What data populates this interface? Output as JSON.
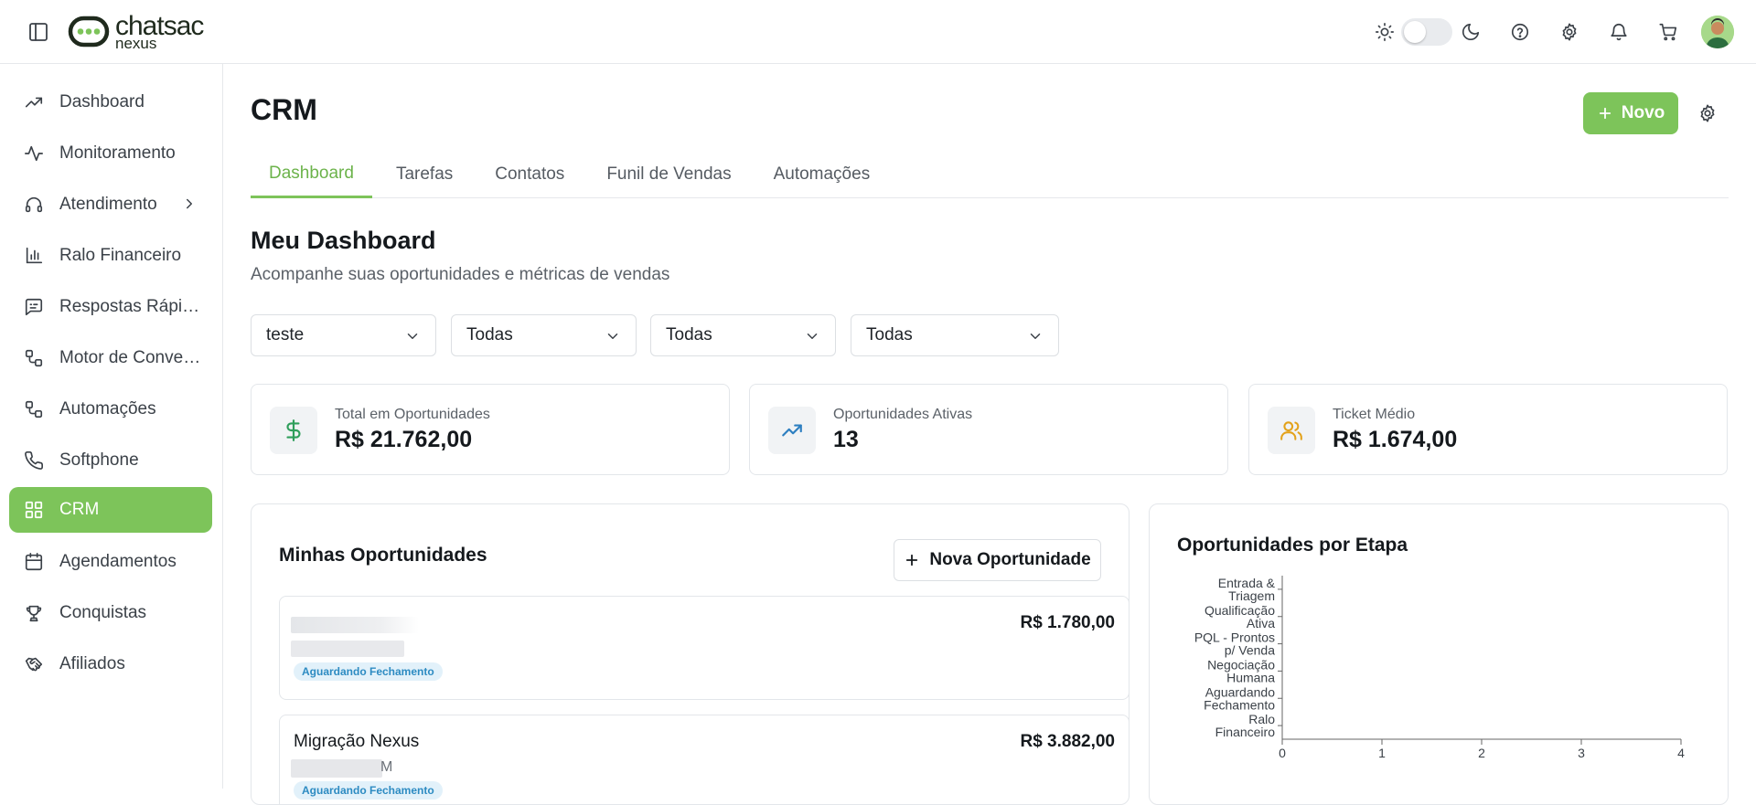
{
  "brand": {
    "line1": "chatsac",
    "line2": "nexus"
  },
  "sidebar": {
    "items": [
      {
        "label": "Dashboard",
        "icon": "trending-up-icon"
      },
      {
        "label": "Monitoramento",
        "icon": "activity-icon"
      },
      {
        "label": "Atendimento",
        "icon": "headset-icon"
      },
      {
        "label": "Ralo Financeiro",
        "icon": "bar-chart-icon"
      },
      {
        "label": "Respostas Rápidas",
        "icon": "message-square-icon"
      },
      {
        "label": "Motor de Conversação",
        "icon": "workflow-icon"
      },
      {
        "label": "Automações",
        "icon": "automation-icon"
      },
      {
        "label": "Softphone",
        "icon": "phone-icon"
      },
      {
        "label": "CRM",
        "icon": "grid-icon"
      },
      {
        "label": "Agendamentos",
        "icon": "calendar-icon"
      },
      {
        "label": "Conquistas",
        "icon": "trophy-icon"
      },
      {
        "label": "Afiliados",
        "icon": "handshake-icon"
      }
    ]
  },
  "page": {
    "title": "CRM",
    "new_button": "Novo"
  },
  "tabs": [
    "Dashboard",
    "Tarefas",
    "Contatos",
    "Funil de Vendas",
    "Automações"
  ],
  "dashboard": {
    "title": "Meu Dashboard",
    "subtitle": "Acompanhe suas oportunidades e métricas de vendas"
  },
  "filters": [
    "teste",
    "Todas",
    "Todas",
    "Todas"
  ],
  "stats": [
    {
      "label": "Total em Oportunidades",
      "value": "R$ 21.762,00",
      "icon": "dollar-icon",
      "color": "#2f9e5b"
    },
    {
      "label": "Oportunidades Ativas",
      "value": "13",
      "icon": "trending-up-icon",
      "color": "#2d7fc1"
    },
    {
      "label": "Ticket Médio",
      "value": "R$ 1.674,00",
      "icon": "users-icon",
      "color": "#e3a21a"
    }
  ],
  "opportunities": {
    "title": "Minhas Oportunidades",
    "new_button": "Nova Oportunidade",
    "items": [
      {
        "name": "",
        "value": "R$ 1.780,00",
        "status": "Aguardando Fechamento"
      },
      {
        "name": "Migração Nexus",
        "value": "R$ 3.882,00",
        "status": "Aguardando Fechamento",
        "partial_detail": "M"
      }
    ]
  },
  "chart_data": {
    "type": "bar",
    "title": "Oportunidades por Etapa",
    "orientation": "horizontal",
    "categories": [
      "Entrada & Triagem",
      "Qualificação Ativa",
      "PQL - Prontos p/ Venda",
      "Negociação Humana",
      "Aguardando Fechamento",
      "Ralo Financeiro"
    ],
    "category_lines": [
      [
        "Entrada &",
        "Triagem"
      ],
      [
        "Qualificação",
        "Ativa"
      ],
      [
        "PQL - Prontos",
        "p/ Venda"
      ],
      [
        "Negociação",
        "Humana"
      ],
      [
        "Aguardando",
        "Fechamento"
      ],
      [
        "Ralo",
        "Financeiro"
      ]
    ],
    "values": [
      0,
      0,
      0,
      0,
      0,
      0
    ],
    "xlim": [
      0,
      4
    ],
    "xticks": [
      "0",
      "1",
      "2",
      "3",
      "4"
    ],
    "grid": false
  },
  "colors": {
    "accent": "#7dc45a",
    "badge_bg": "#e2f1fa",
    "badge_text": "#2d8bc2"
  }
}
